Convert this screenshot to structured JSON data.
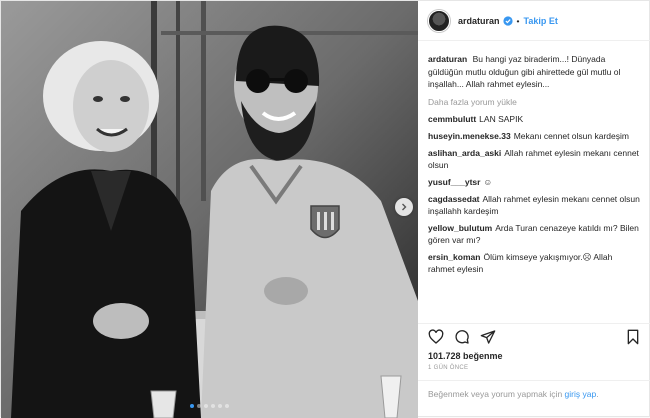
{
  "post": {
    "username": "ardaturan",
    "follow_label": "Takip Et",
    "separator": "•",
    "caption_user": "ardaturan",
    "caption_text": "Bu hangi yaz biraderim...! Dünyada güldüğün mutlu olduğun gibi ahirettede gül mutlu ol inşallah... Allah rahmet eylesin...",
    "load_more": "Daha fazla yorum yükle",
    "comments": [
      {
        "user": "cemmbulutt",
        "text": "LAN SAPIK"
      },
      {
        "user": "huseyin.menekse.33",
        "text": "Mekanı cennet olsun kardeşim"
      },
      {
        "user": "aslihan_arda_aski",
        "text": "Allah rahmet eylesin mekanı cennet olsun"
      },
      {
        "user": "yusuf___ytsr",
        "text": "☺"
      },
      {
        "user": "cagdassedat",
        "text": "Allah rahmet eylesin mekanı cennet olsun inşallahh kardeşim"
      },
      {
        "user": "yellow_bulutum",
        "text": "Arda Turan cenazeye katıldı mı? Bilen gören var mı?"
      },
      {
        "user": "ersin_koman",
        "text": "Ölüm kimseye yakışmıyor.☹ Allah rahmet eylesin"
      }
    ],
    "likes": "101.728 beğenme",
    "time_ago": "1 GÜN ÖNCE",
    "login_prompt": "Beğenmek veya yorum yapmak için",
    "login_link": "giriş yap",
    "login_end": ".",
    "carousel": {
      "count": 6,
      "active_index": 0
    },
    "colors": {
      "accent": "#3897f0",
      "muted": "#999999",
      "text": "#262626"
    },
    "icons": [
      "heart-icon",
      "comment-icon",
      "share-icon",
      "bookmark-icon",
      "verified-badge-icon",
      "chevron-right-icon"
    ]
  }
}
